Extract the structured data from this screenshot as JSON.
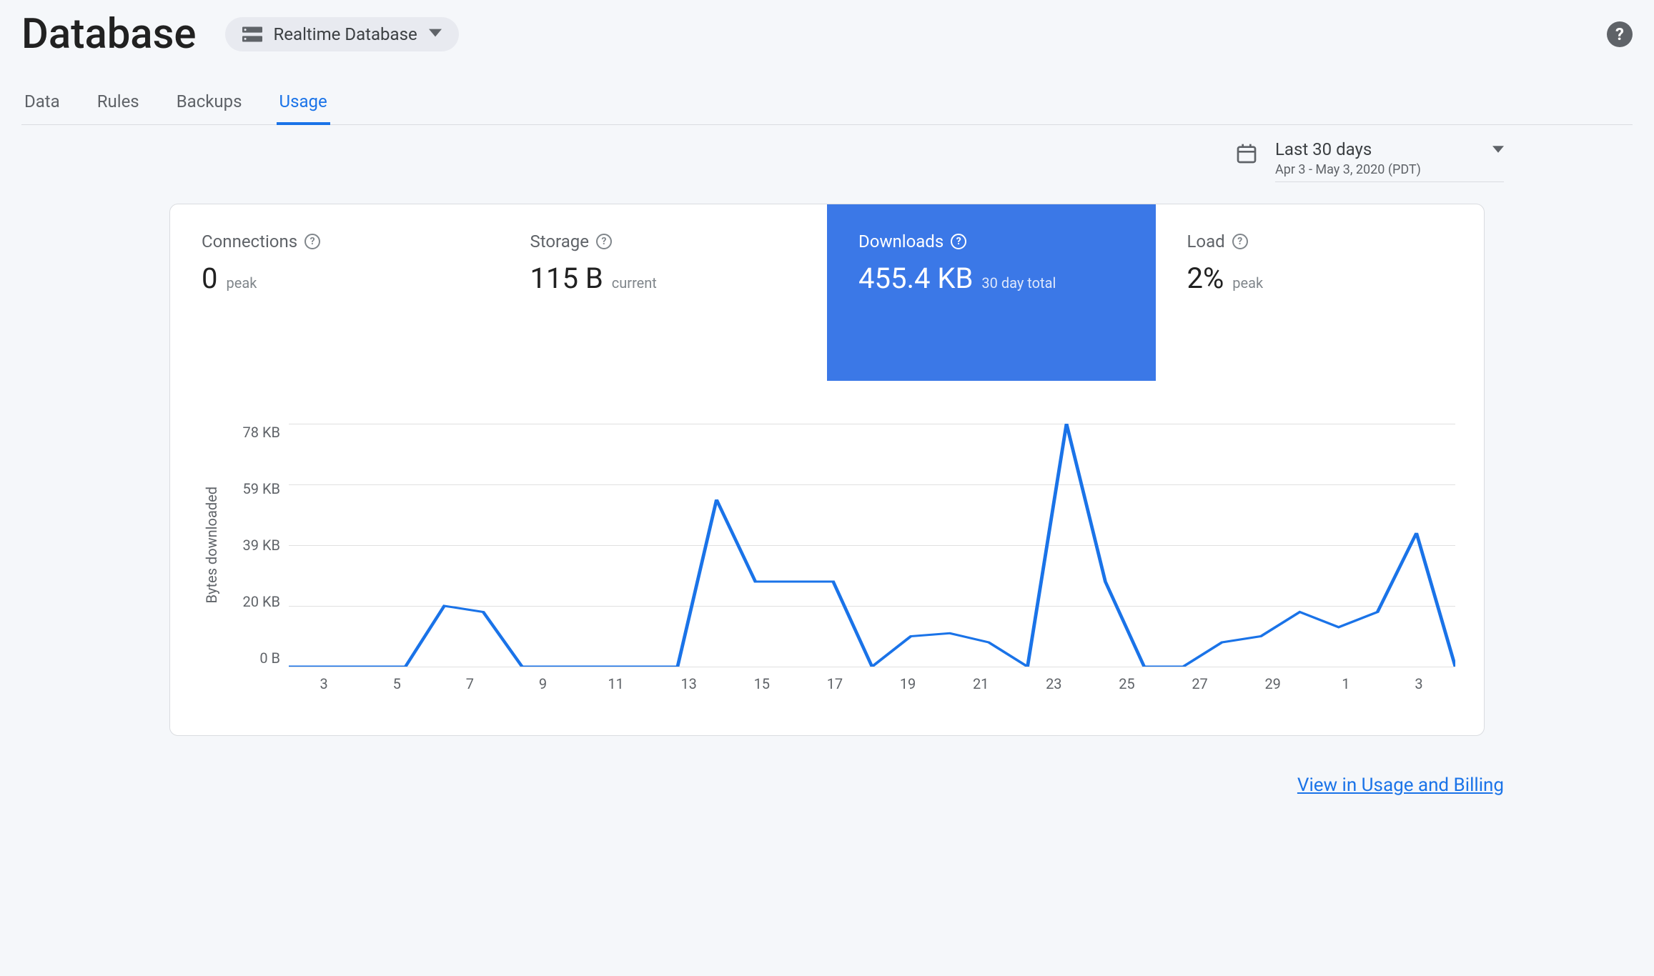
{
  "header": {
    "title": "Database",
    "selector_label": "Realtime Database"
  },
  "tabs": [
    "Data",
    "Rules",
    "Backups",
    "Usage"
  ],
  "active_tab": "Usage",
  "date_range": {
    "main": "Last 30 days",
    "sub": "Apr 3 - May 3, 2020 (PDT)"
  },
  "metrics": {
    "connections": {
      "label": "Connections",
      "value": "0",
      "sub": "peak"
    },
    "storage": {
      "label": "Storage",
      "value": "115 B",
      "sub": "current"
    },
    "downloads": {
      "label": "Downloads",
      "value": "455.4 KB",
      "sub": "30 day total",
      "selected": true
    },
    "load": {
      "label": "Load",
      "value": "2%",
      "sub": "peak"
    }
  },
  "footer_link": "View in Usage and Billing",
  "colors": {
    "accent": "#3b78e7",
    "line": "#1a73e8"
  },
  "chart_data": {
    "type": "line",
    "title": "Downloads",
    "xlabel": "",
    "ylabel": "Bytes downloaded",
    "x_ticks": [
      "3",
      "5",
      "7",
      "9",
      "11",
      "13",
      "15",
      "17",
      "19",
      "21",
      "23",
      "25",
      "27",
      "29",
      "1",
      "3"
    ],
    "y_ticks": [
      "0 B",
      "20 KB",
      "39 KB",
      "59 KB",
      "78 KB"
    ],
    "ylim": [
      0,
      80
    ],
    "x": [
      3,
      4,
      5,
      6,
      7,
      8,
      9,
      10,
      11,
      12,
      13,
      14,
      15,
      16,
      17,
      18,
      19,
      20,
      21,
      22,
      23,
      24,
      25,
      26,
      27,
      28,
      29,
      30,
      1,
      2,
      3
    ],
    "values_kb": [
      0,
      0,
      0,
      0,
      20,
      18,
      0,
      0,
      0,
      0,
      0,
      55,
      28,
      28,
      28,
      0,
      10,
      11,
      8,
      0,
      80,
      28,
      0,
      0,
      8,
      10,
      18,
      13,
      18,
      44,
      0
    ]
  }
}
